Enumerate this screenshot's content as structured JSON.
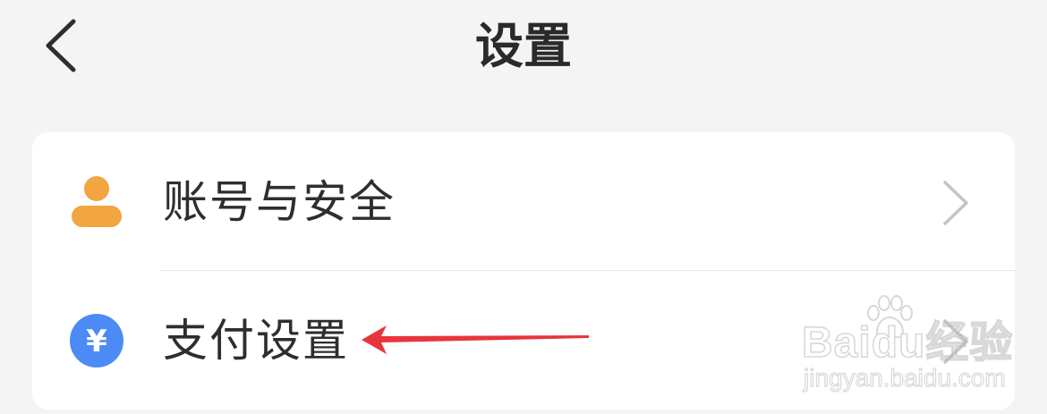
{
  "header": {
    "title": "设置",
    "back_icon": "chevron-left-icon"
  },
  "settings": {
    "items": [
      {
        "label": "账号与安全",
        "icon": "user-icon",
        "icon_color": "#f2a541"
      },
      {
        "label": "支付设置",
        "icon": "yuan-icon",
        "icon_color": "#4c8bf5",
        "icon_glyph": "¥"
      }
    ]
  },
  "annotation": {
    "arrow_color": "#e8343c"
  },
  "watermark": {
    "brand": "Baidu经验",
    "url": "jingyan.baidu.com"
  }
}
